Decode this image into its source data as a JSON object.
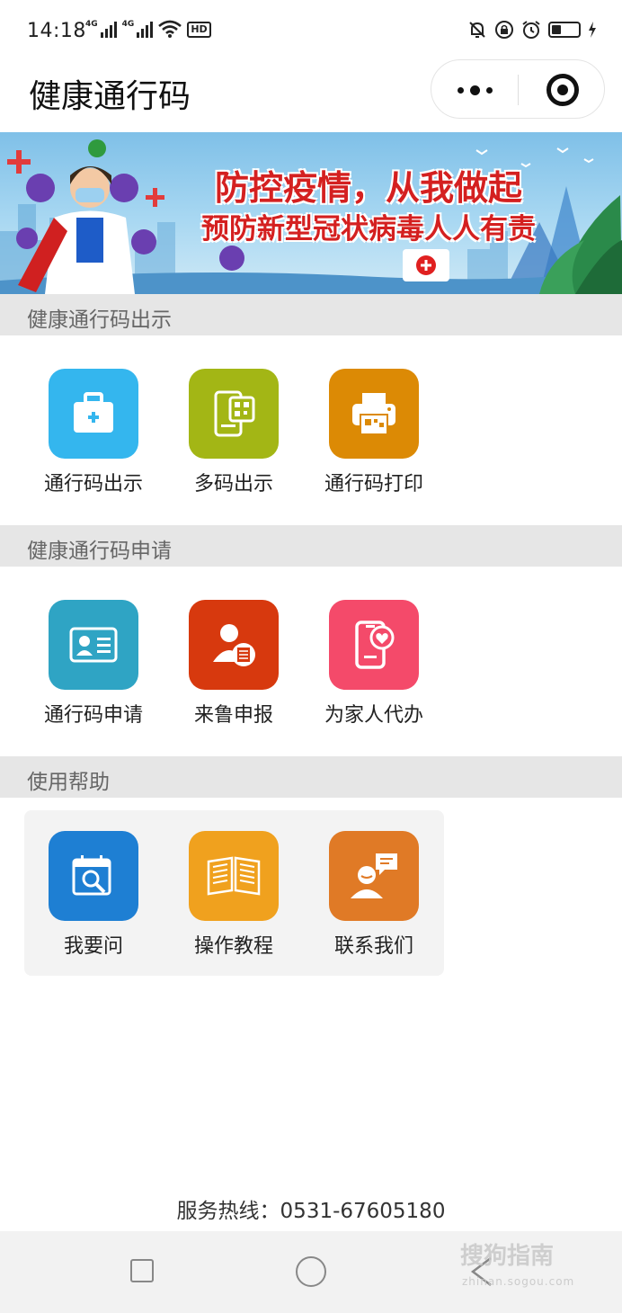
{
  "status_bar": {
    "time": "14:18",
    "network_1": "4G",
    "network_2": "4G",
    "hd": "HD",
    "icons": [
      "signal-icon",
      "signal-icon",
      "wifi-icon",
      "hd-icon",
      "mute-icon",
      "lock-rotation-icon",
      "alarm-icon",
      "battery-icon",
      "charging-icon"
    ]
  },
  "header": {
    "title": "健康通行码",
    "more_icon": "more-dots-icon",
    "close_icon": "target-close-icon"
  },
  "banner": {
    "line1": "防控疫情，从我做起",
    "line2": "预防新型冠状病毒人人有责"
  },
  "sections": [
    {
      "title": "健康通行码出示",
      "items": [
        {
          "label": "通行码出示",
          "icon": "medical-kit-icon",
          "color": "#34b6ee"
        },
        {
          "label": "多码出示",
          "icon": "phone-qr-icon",
          "color": "#a3b615"
        },
        {
          "label": "通行码打印",
          "icon": "printer-icon",
          "color": "#dc8a05"
        }
      ]
    },
    {
      "title": "健康通行码申请",
      "items": [
        {
          "label": "通行码申请",
          "icon": "id-card-icon",
          "color": "#2fa4c4"
        },
        {
          "label": "来鲁申报",
          "icon": "person-document-icon",
          "color": "#d7390e"
        },
        {
          "label": "为家人代办",
          "icon": "phone-heart-icon",
          "color": "#f44a6a"
        }
      ]
    },
    {
      "title": "使用帮助",
      "items": [
        {
          "label": "我要问",
          "icon": "calendar-search-icon",
          "color": "#1e7fd3"
        },
        {
          "label": "操作教程",
          "icon": "open-book-icon",
          "color": "#f0a11e"
        },
        {
          "label": "联系我们",
          "icon": "customer-service-icon",
          "color": "#e07a26"
        }
      ]
    }
  ],
  "footer": {
    "hotline": "服务热线：0531-67605180"
  },
  "nav_bar": {
    "icons": [
      "recent-apps-icon",
      "home-icon",
      "back-icon"
    ]
  },
  "watermark": {
    "text": "搜狗指南",
    "url": "zhinan.sogou.com"
  }
}
